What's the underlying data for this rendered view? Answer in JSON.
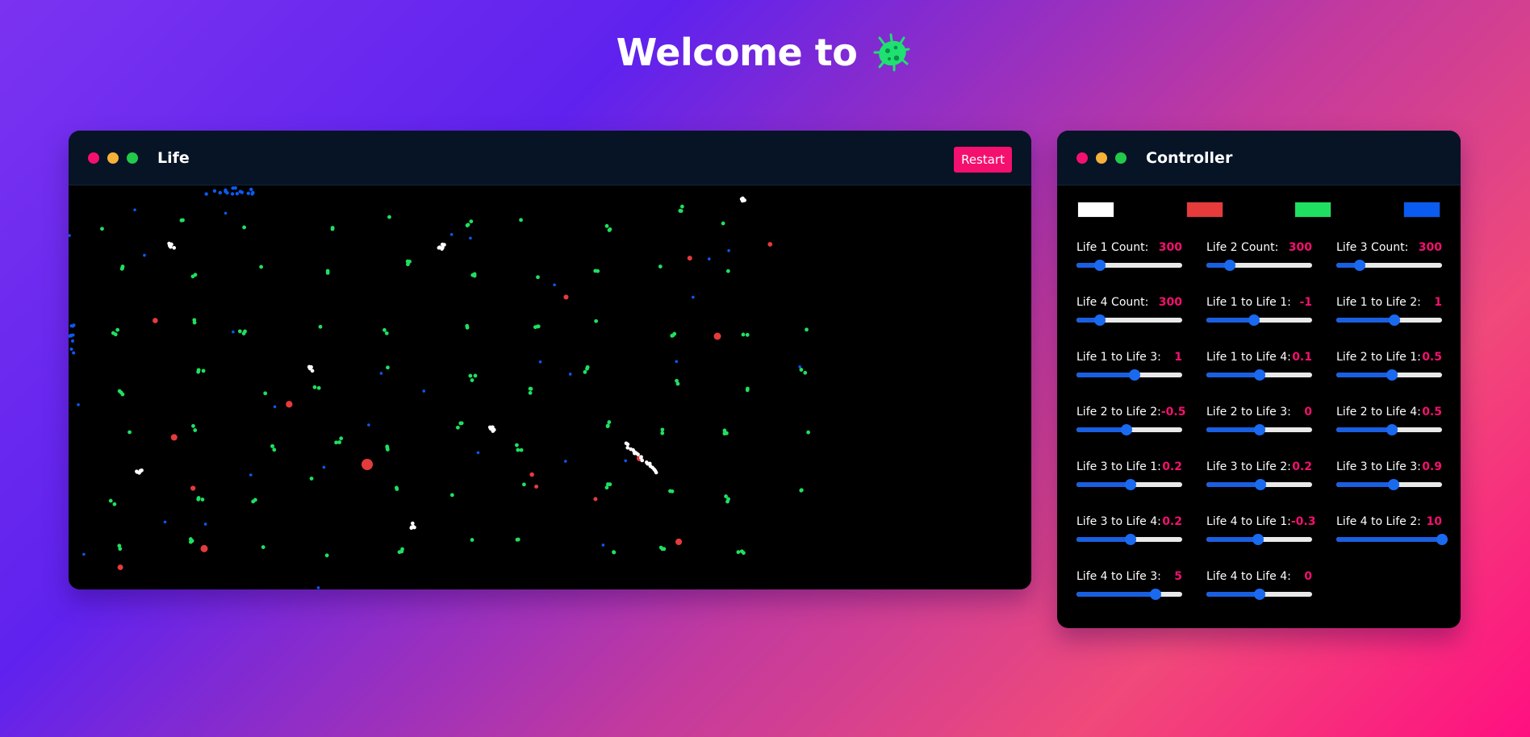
{
  "header": {
    "title": "Welcome to",
    "logo_icon": "bacteria-icon",
    "logo_color": "#1fe070"
  },
  "life_window": {
    "title": "Life",
    "restart_label": "Restart",
    "dot_colors": [
      "#f4106e",
      "#f6b13a",
      "#22c94a"
    ]
  },
  "controller": {
    "title": "Controller",
    "swatches": [
      {
        "name": "life-1-color",
        "color": "#ffffff"
      },
      {
        "name": "life-2-color",
        "color": "#e53b3b"
      },
      {
        "name": "life-3-color",
        "color": "#1fe060"
      },
      {
        "name": "life-4-color",
        "color": "#0a5bf0"
      }
    ],
    "controls": [
      {
        "label": "Life 1 Count:",
        "value": "300",
        "level": 0.22
      },
      {
        "label": "Life 2 Count:",
        "value": "300",
        "level": 0.22
      },
      {
        "label": "Life 3 Count:",
        "value": "300",
        "level": 0.22
      },
      {
        "label": "Life 4 Count:",
        "value": "300",
        "level": 0.22
      },
      {
        "label": "Life 1 to Life 1:",
        "value": "-1",
        "level": 0.45
      },
      {
        "label": "Life 1 to Life 2:",
        "value": "1",
        "level": 0.55
      },
      {
        "label": "Life 1 to Life 3:",
        "value": "1",
        "level": 0.55
      },
      {
        "label": "Life 1 to Life 4:",
        "value": "0.1",
        "level": 0.505
      },
      {
        "label": "Life 2 to Life 1:",
        "value": "0.5",
        "level": 0.525
      },
      {
        "label": "Life 2 to Life 2:",
        "value": "-0.5",
        "level": 0.475
      },
      {
        "label": "Life 2 to Life 3:",
        "value": "0",
        "level": 0.5
      },
      {
        "label": "Life 2 to Life 4:",
        "value": "0.5",
        "level": 0.525
      },
      {
        "label": "Life 3 to Life 1:",
        "value": "0.2",
        "level": 0.51
      },
      {
        "label": "Life 3 to Life 2:",
        "value": "0.2",
        "level": 0.51
      },
      {
        "label": "Life 3 to Life 3:",
        "value": "0.9",
        "level": 0.545
      },
      {
        "label": "Life 3 to Life 4:",
        "value": "0.2",
        "level": 0.51
      },
      {
        "label": "Life 4 to Life 1:",
        "value": "-0.3",
        "level": 0.485
      },
      {
        "label": "Life 4 to Life 2:",
        "value": "10",
        "level": 1.0
      },
      {
        "label": "Life 4 to Life 3:",
        "value": "5",
        "level": 0.75
      },
      {
        "label": "Life 4 to Life 4:",
        "value": "0",
        "level": 0.5
      }
    ]
  }
}
